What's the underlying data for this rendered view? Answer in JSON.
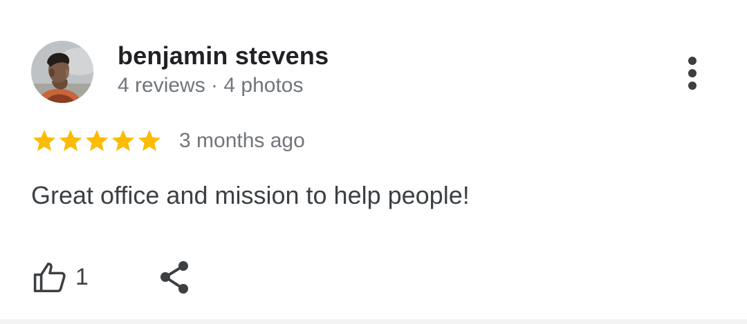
{
  "reviewer": {
    "name": "benjamin stevens",
    "meta": "4 reviews · 4 photos",
    "avatar_icon": "profile-photo"
  },
  "review": {
    "rating": 5,
    "max_rating": 5,
    "date": "3 months ago",
    "text": "Great office and mission to help people!",
    "likes": "1"
  },
  "icons": {
    "more": "more-vert-icon",
    "like": "thumbs-up-icon",
    "share": "share-icon",
    "star": "star-icon"
  },
  "colors": {
    "star": "#fbbc04",
    "name": "#202124",
    "secondary_text": "#70757a",
    "body_text": "#3c4043"
  }
}
